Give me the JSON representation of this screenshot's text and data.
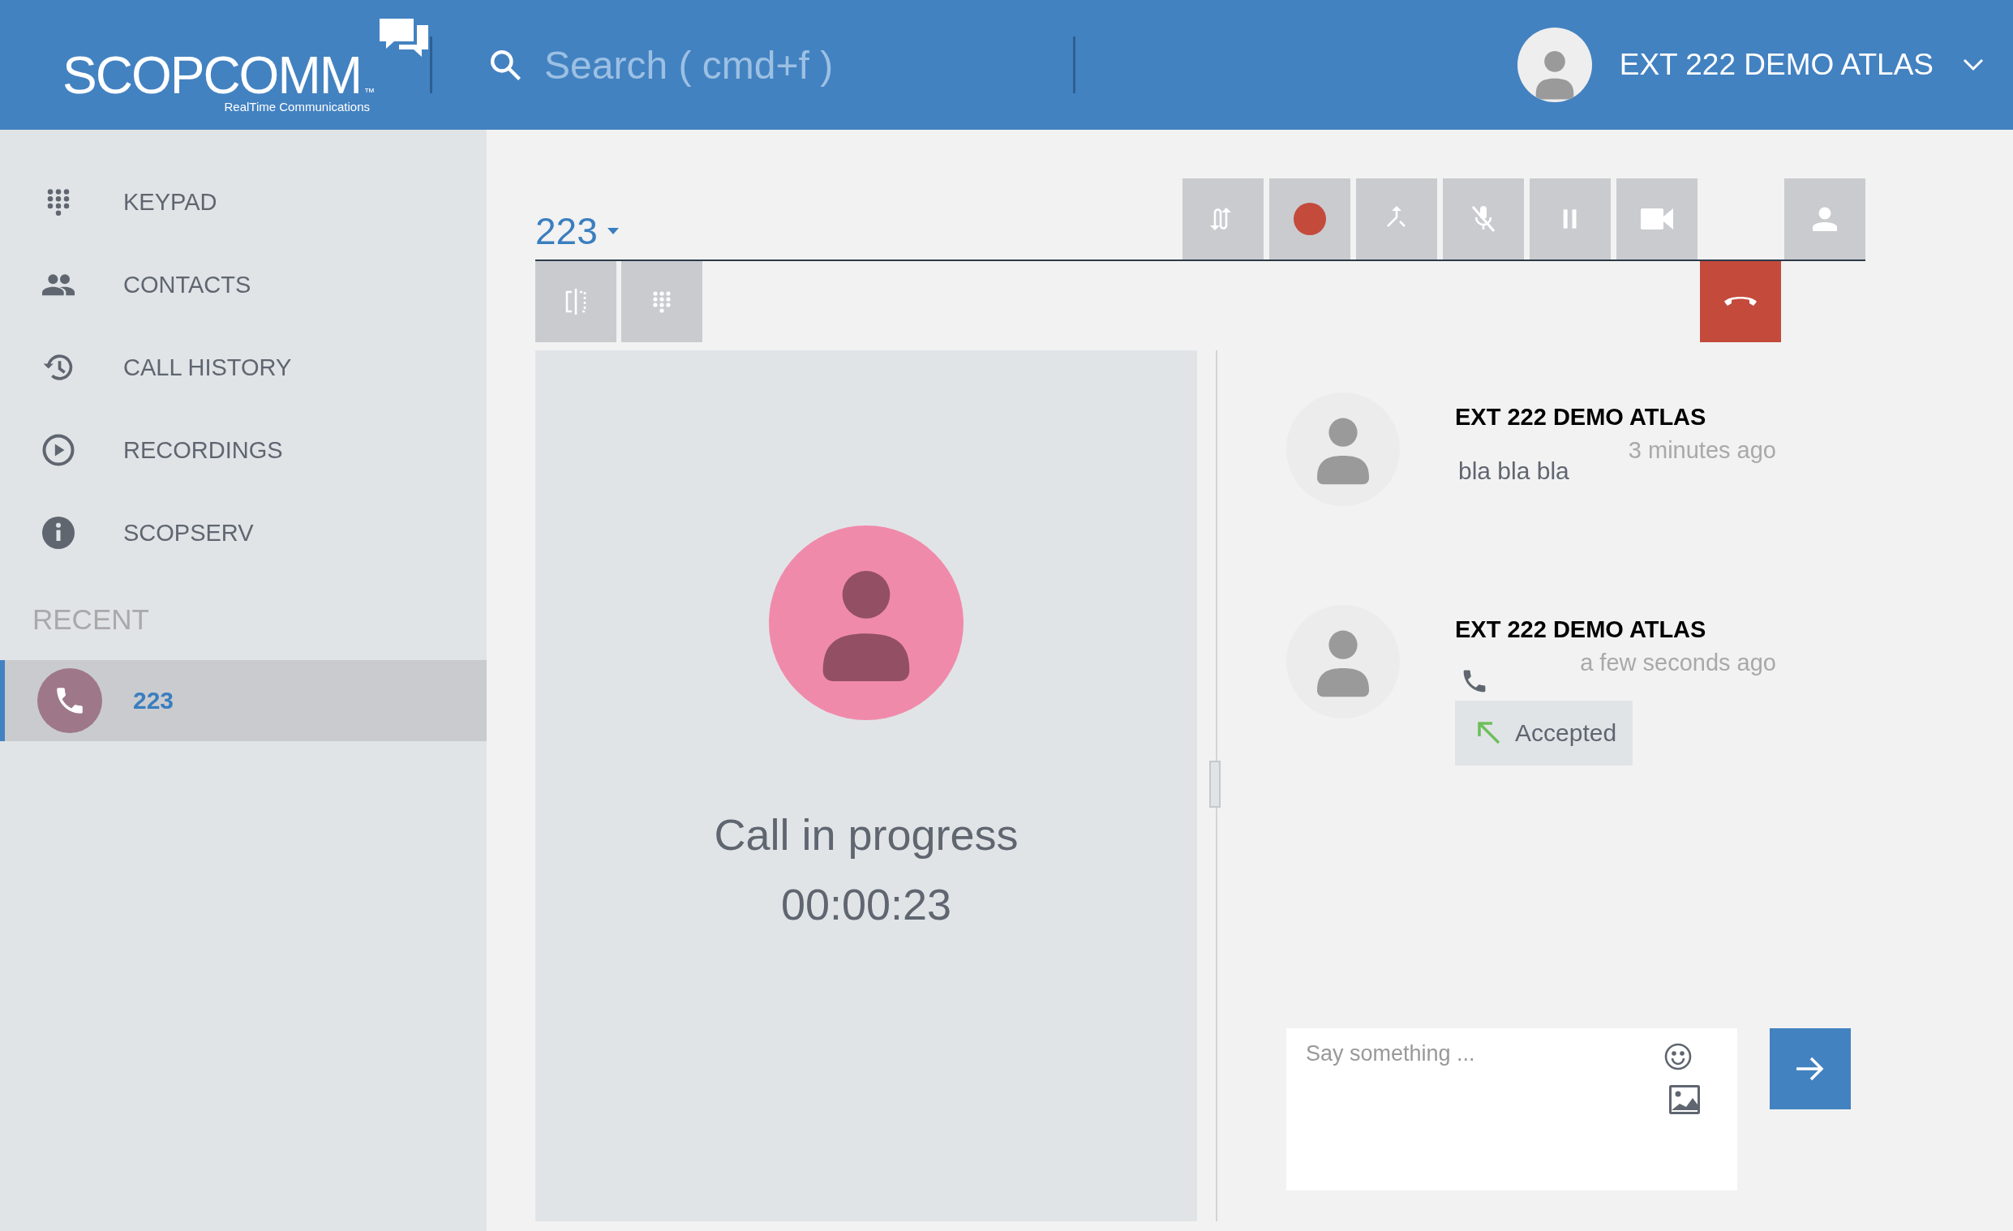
{
  "header": {
    "logo": {
      "name": "SCOPCOMM",
      "trademark": "™",
      "tagline": "RealTime Communications"
    },
    "search": {
      "placeholder": "Search ( cmd+f )"
    },
    "user": {
      "name": "EXT 222 DEMO ATLAS"
    }
  },
  "sidebar": {
    "items": [
      {
        "kind": "keypad",
        "label": "KEYPAD"
      },
      {
        "kind": "contacts",
        "label": "CONTACTS"
      },
      {
        "kind": "history",
        "label": "CALL HISTORY"
      },
      {
        "kind": "play",
        "label": "RECORDINGS"
      },
      {
        "kind": "info",
        "label": "SCOPSERV"
      }
    ],
    "section": "RECENT",
    "recent": [
      {
        "label": "223",
        "selected": true
      }
    ]
  },
  "call": {
    "title": "223",
    "top_buttons": [
      {
        "kind": "transfer"
      },
      {
        "kind": "record"
      },
      {
        "kind": "merge"
      },
      {
        "kind": "mute"
      },
      {
        "kind": "pause"
      },
      {
        "kind": "video"
      },
      {
        "kind": "contact"
      }
    ],
    "bottom_buttons": [
      {
        "kind": "split"
      },
      {
        "kind": "keypad"
      },
      {
        "kind": "hangup"
      }
    ],
    "status": "Call in progress",
    "timer": "00:00:23"
  },
  "chat": {
    "messages": [
      {
        "kind": "text",
        "sender": "EXT 222 DEMO ATLAS",
        "time": "3 minutes ago",
        "body": "bla bla bla"
      },
      {
        "kind": "call",
        "sender": "EXT 222 DEMO ATLAS",
        "time": "a few seconds ago",
        "status": "Accepted"
      }
    ],
    "input": {
      "placeholder": "Say something ..."
    }
  }
}
